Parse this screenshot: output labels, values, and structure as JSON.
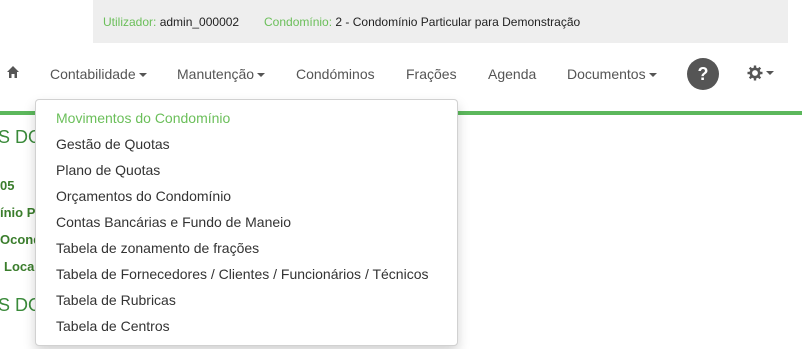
{
  "infobar": {
    "user_label": "Utilizador:",
    "user_value": "admin_000002",
    "condo_label": "Condomínio:",
    "condo_value": "2 - Condomínio Particular para Demonstração"
  },
  "nav": {
    "items": [
      {
        "label": "Contabilidade",
        "dropdown": true
      },
      {
        "label": "Manutenção",
        "dropdown": true
      },
      {
        "label": "Condóminos",
        "dropdown": false
      },
      {
        "label": "Frações",
        "dropdown": false
      },
      {
        "label": "Agenda",
        "dropdown": false
      },
      {
        "label": "Documentos",
        "dropdown": true
      }
    ],
    "help_label": "?"
  },
  "dropdown": {
    "items": [
      {
        "label": "Movimentos do Condomínio",
        "active": true
      },
      {
        "label": "Gestão de Quotas"
      },
      {
        "label": "Plano de Quotas"
      },
      {
        "label": "Orçamentos do Condomínio"
      },
      {
        "label": "Contas Bancárias e Fundo de Maneio"
      },
      {
        "label": "Tabela de zonamento de frações"
      },
      {
        "label": "Tabela de Fornecedores / Clientes / Funcionários / Técnicos"
      },
      {
        "label": "Tabela de Rubricas"
      },
      {
        "label": "Tabela de Centros"
      }
    ]
  },
  "background": {
    "heading1": "S DO",
    "line1": "05",
    "line2": "ínio P",
    "line3": "Ocond",
    "line4": "Loca",
    "heading2": "S DO"
  },
  "colors": {
    "accent_green": "#5cb85c",
    "label_green": "#6bbf5a",
    "help_bg": "#555555"
  }
}
